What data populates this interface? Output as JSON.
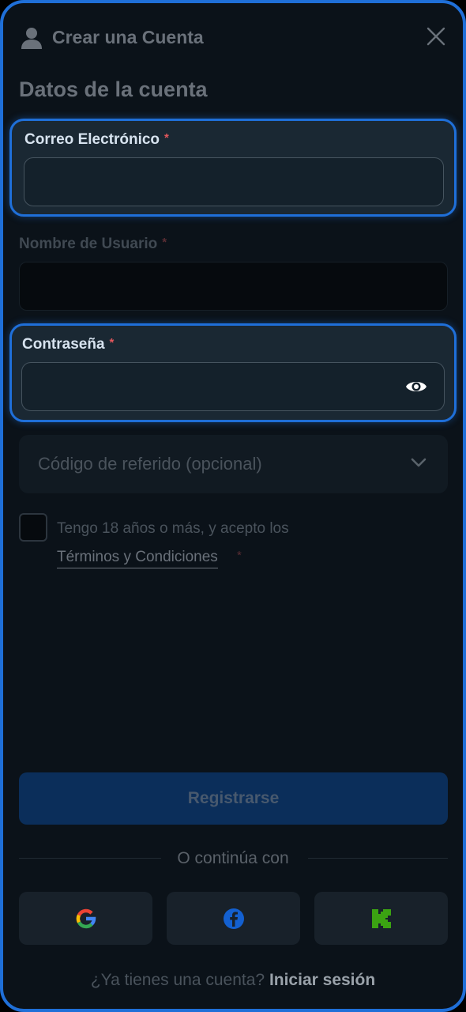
{
  "header": {
    "title": "Crear una Cuenta"
  },
  "form": {
    "section_title": "Datos de la cuenta",
    "email": {
      "label": "Correo Electrónico",
      "required_mark": "*",
      "value": ""
    },
    "username": {
      "label": "Nombre de Usuario",
      "required_mark": "*",
      "value": ""
    },
    "password": {
      "label": "Contraseña",
      "required_mark": "*",
      "value": ""
    },
    "referral": {
      "label": "Código de referido (opcional)"
    },
    "terms": {
      "text": "Tengo 18 años o más, y acepto los",
      "link": "Términos y Condiciones",
      "required_mark": "*"
    },
    "submit_label": "Registrarse"
  },
  "social": {
    "divider_text": "O continúa con",
    "providers": [
      "google-icon",
      "facebook-icon",
      "kick-icon"
    ]
  },
  "footer": {
    "question": "¿Ya tienes una cuenta?",
    "login_link": "Iniciar sesión"
  },
  "colors": {
    "accent": "#1f6fd8",
    "background": "#0b1219",
    "required": "#e4575c"
  }
}
